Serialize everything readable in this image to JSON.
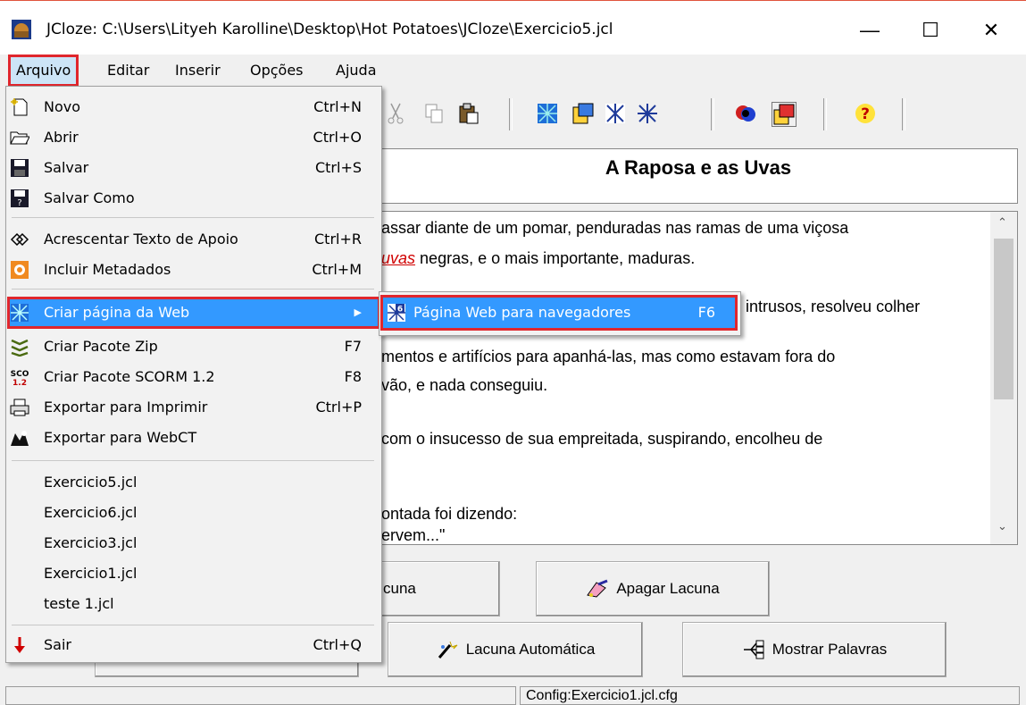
{
  "window": {
    "title": "JCloze: C:\\Users\\Lityeh Karolline\\Desktop\\Hot Potatoes\\JCloze\\Exercicio5.jcl",
    "minimize": "—",
    "maximize": "☐",
    "close": "✕"
  },
  "menubar": {
    "items": [
      "Arquivo",
      "Editar",
      "Inserir",
      "Opções",
      "Ajuda"
    ]
  },
  "document": {
    "title": "A Raposa e as Uvas",
    "lines": [
      "assar diante de um pomar, penduradas nas ramas de uma viçosa",
      "negras, e o mais importante, maduras.",
      "intrusos, resolveu colher",
      "mentos e artifícios para apanhá-las, mas como estavam fora do",
      "vão, e nada conseguiu.",
      "com o insucesso de sua empreitada, suspirando, encolheu de",
      "ontada foi dizendo:",
      "ervem...\""
    ],
    "gap_word": "uvas"
  },
  "buttons": {
    "criar_lacuna": "cuna",
    "apagar_lacuna": "Apagar Lacuna",
    "lacuna_automatica": "Lacuna Automática",
    "mostrar_palavras": "Mostrar Palavras"
  },
  "status": {
    "config": "Config:Exercicio1.jcl.cfg"
  },
  "file_menu": {
    "novo": {
      "label": "Novo",
      "shortcut": "Ctrl+N"
    },
    "abrir": {
      "label": "Abrir",
      "shortcut": "Ctrl+O"
    },
    "salvar": {
      "label": "Salvar",
      "shortcut": "Ctrl+S"
    },
    "salvar_como": {
      "label": "Salvar Como",
      "shortcut": ""
    },
    "texto_apoio": {
      "label": "Acrescentar Texto de Apoio",
      "shortcut": "Ctrl+R"
    },
    "metadados": {
      "label": "Incluir Metadados",
      "shortcut": "Ctrl+M"
    },
    "criar_web": {
      "label": "Criar página da Web",
      "shortcut": "▶"
    },
    "zip": {
      "label": "Criar Pacote Zip",
      "shortcut": "F7"
    },
    "scorm": {
      "label": "Criar Pacote SCORM 1.2",
      "shortcut": "F8"
    },
    "imprimir": {
      "label": "Exportar para Imprimir",
      "shortcut": "Ctrl+P"
    },
    "webct": {
      "label": "Exportar para WebCT",
      "shortcut": ""
    },
    "recent": [
      "Exercicio5.jcl",
      "Exercicio6.jcl",
      "Exercicio3.jcl",
      "Exercicio1.jcl",
      "teste 1.jcl"
    ],
    "sair": {
      "label": "Sair",
      "shortcut": "Ctrl+Q"
    }
  },
  "submenu": {
    "label": "Página Web para navegadores",
    "shortcut": "F6"
  }
}
